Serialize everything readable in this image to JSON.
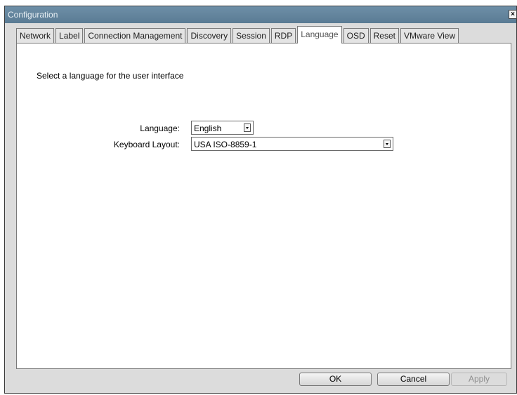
{
  "window": {
    "title": "Configuration",
    "close_glyph": "×"
  },
  "tabs": [
    {
      "label": "Network"
    },
    {
      "label": "Label"
    },
    {
      "label": "Connection Management"
    },
    {
      "label": "Discovery"
    },
    {
      "label": "Session"
    },
    {
      "label": "RDP"
    },
    {
      "label": "Language",
      "active": true
    },
    {
      "label": "OSD"
    },
    {
      "label": "Reset"
    },
    {
      "label": "VMware View"
    }
  ],
  "panel": {
    "intro": "Select a language for the user interface",
    "language_label": "Language:",
    "language_value": "English",
    "keyboard_label": "Keyboard Layout:",
    "keyboard_value": "USA ISO-8859-1"
  },
  "buttons": {
    "ok": "OK",
    "cancel": "Cancel",
    "apply": "Apply"
  }
}
